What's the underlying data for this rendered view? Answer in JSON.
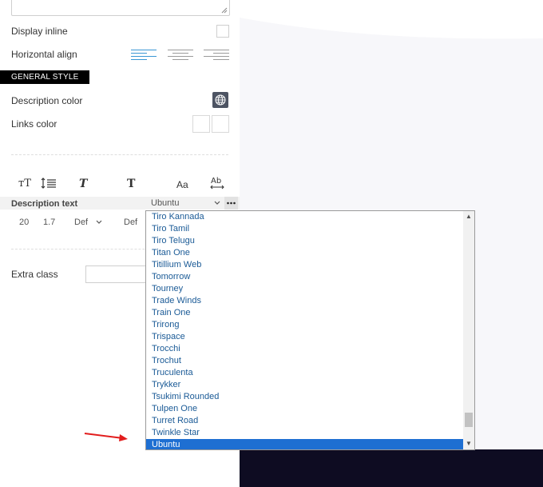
{
  "panel": {
    "display_inline_label": "Display inline",
    "horizontal_align_label": "Horizontal align",
    "general_style_badge": "GENERAL STYLE",
    "description_color_label": "Description color",
    "links_color_label": "Links color",
    "typography_icons": [
      "font-size-icon",
      "line-height-icon",
      "font-style-icon",
      "font-weight-icon",
      "text-transform-icon",
      "letter-spacing-icon"
    ],
    "description_text_label": "Description text",
    "font_family_value": "Ubuntu",
    "font_size_value": "20",
    "line_height_value": "1.7",
    "font_style_value": "Def",
    "font_weight_value": "Def",
    "extra_class_label": "Extra class",
    "extra_class_value": ""
  },
  "dropdown": {
    "options": [
      "Tiro Kannada",
      "Tiro Tamil",
      "Tiro Telugu",
      "Titan One",
      "Titillium Web",
      "Tomorrow",
      "Tourney",
      "Trade Winds",
      "Train One",
      "Trirong",
      "Trispace",
      "Trocchi",
      "Trochut",
      "Truculenta",
      "Trykker",
      "Tsukimi Rounded",
      "Tulpen One",
      "Turret Road",
      "Twinkle Star",
      "Ubuntu"
    ],
    "selected": "Ubuntu"
  },
  "colors": {
    "selected_option_bg": "#1e6fd2",
    "option_text": "#1a5a96",
    "footer_dark": "#0e0c22",
    "align_active": "#3a97d4",
    "annotation_arrow": "#e21d1d"
  }
}
